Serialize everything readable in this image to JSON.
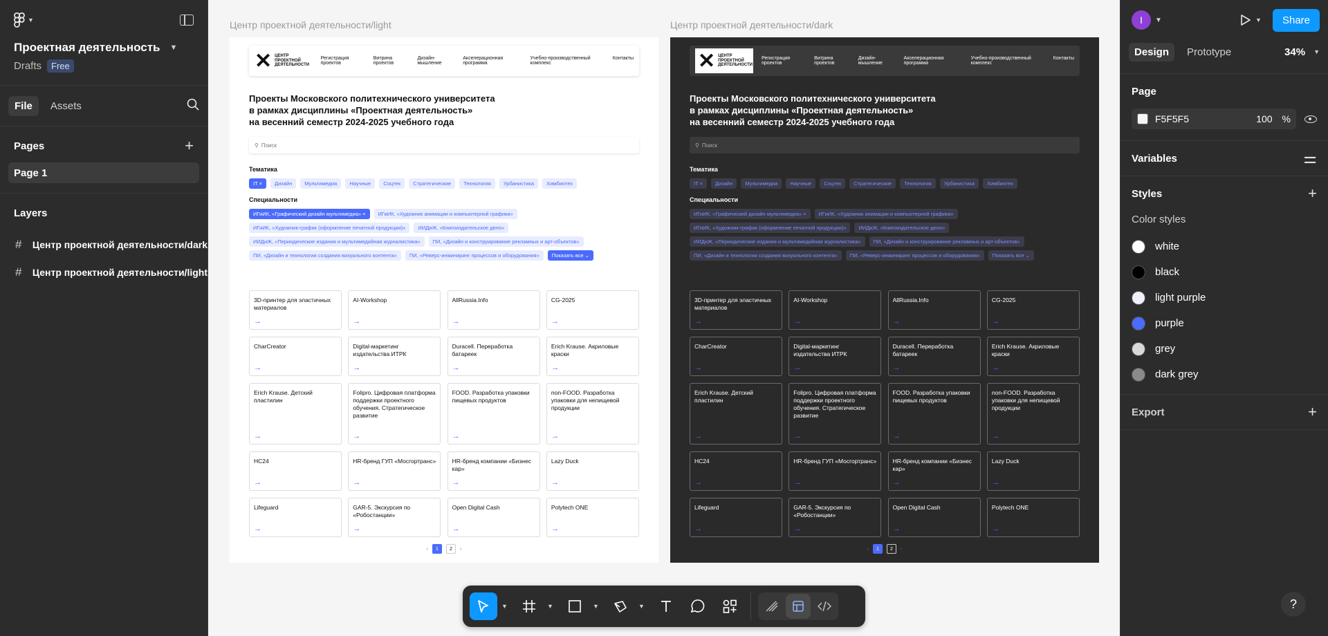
{
  "left_panel": {
    "project_title": "Проектная деятельность",
    "drafts_label": "Drafts",
    "plan_badge": "Free",
    "tabs": [
      "File",
      "Assets"
    ],
    "pages_heading": "Pages",
    "pages": [
      "Page 1"
    ],
    "layers_heading": "Layers",
    "layers": [
      "Центр проектной деятельности/dark",
      "Центр проектной деятельности/light"
    ]
  },
  "right_panel": {
    "avatar_initial": "I",
    "share_label": "Share",
    "tabs": [
      "Design",
      "Prototype"
    ],
    "zoom": "34%",
    "page_heading": "Page",
    "page_color": "F5F5F5",
    "page_opacity": "100",
    "percent_sign": "%",
    "variables_heading": "Variables",
    "styles_heading": "Styles",
    "color_styles_label": "Color styles",
    "color_styles": [
      {
        "name": "white",
        "color": "#ffffff"
      },
      {
        "name": "black",
        "color": "#000000"
      },
      {
        "name": "light purple",
        "color": "#f0f0fa"
      },
      {
        "name": "purple",
        "color": "#4b6bfb"
      },
      {
        "name": "grey",
        "color": "#d9d9d9"
      },
      {
        "name": "dark grey",
        "color": "#8a8a8a"
      }
    ],
    "export_heading": "Export"
  },
  "canvas": {
    "frames": [
      {
        "label": "Центр проектной деятельности/light",
        "theme": "light"
      },
      {
        "label": "Центр проектной деятельности/dark",
        "theme": "dark"
      }
    ],
    "site": {
      "logo_text": "ЦЕНТР ПРОЕКТНОЙ ДЕЯТЕЛЬНОСТИ",
      "nav_links": [
        "Регистрация проектов",
        "Витрина проектов",
        "Дизайн-мышление",
        "Акселерационная программа",
        "Учебно-производственный комплекс",
        "Контакты"
      ],
      "heading_lines": [
        "Проекты Московского политехнического университета",
        "в рамках дисциплины «Проектная деятельность»",
        "на весенний семестр 2024-2025 учебного года"
      ],
      "search_placeholder": "Поиск",
      "topics_heading": "Тематика",
      "topics": [
        "IT ×",
        "Дизайн",
        "Мультимедиа",
        "Научные",
        "Соцтех",
        "Стратегические",
        "Технология",
        "Урбанистика",
        "Химбиотех"
      ],
      "specialties_heading": "Специальности",
      "specialties": [
        "ИГиИК, «Графический дизайн мультимедиа» ×",
        "ИГиИК, «Художник анимации и компьютерной графики»",
        "ИГиИК, «Художник-график (оформление печатной продукции)»",
        "ИИДиЖ, «Книгоиздательское дело»",
        "ИИДиЖ, «Периодические издания и мультимедийная журналистика»",
        "ПИ, «Дизайн и конструирование рекламных и арт-объектов»",
        "ПИ, «Дизайн и технологии создания визуального контента»",
        "ПИ, «Реверс-инжиниринг процессов и оборудования»",
        "Показать все ⌄"
      ],
      "cards": [
        "3D-принтер для эластичных материалов",
        "AI-Workshop",
        "AllRussia.Info",
        "CG-2025",
        "CharCreator",
        "Digital-маркетинг издательства ИТРК",
        "Duracell. Переработка батареек",
        "Erich Krause. Акриловые краски",
        "Erich Krause. Детский пластилин",
        "Folipro. Цифровая платформа поддержки проектного обучения. Стратегическое развитие",
        "FOOD. Разработка упаковки пищевых продуктов",
        "non-FOOD. Разработка упаковки для непищевой продукции",
        "HC24",
        "HR-бренд ГУП «Мосгортранс»",
        "HR-бренд компании «Бизнес кар»",
        "Lazy Duck",
        "Lifeguard",
        "GAR-5. Экскурсия по «Робостанции»",
        "Open Digital Cash",
        "Polytech ONE"
      ],
      "arrow": "→",
      "pages": [
        "‹",
        "1",
        "2",
        "›"
      ]
    }
  },
  "toolbar": {
    "tools": [
      "move-tool",
      "frame-tool",
      "shape-tool",
      "pen-tool",
      "text-tool",
      "comment-tool",
      "actions-tool"
    ]
  },
  "help_label": "?"
}
